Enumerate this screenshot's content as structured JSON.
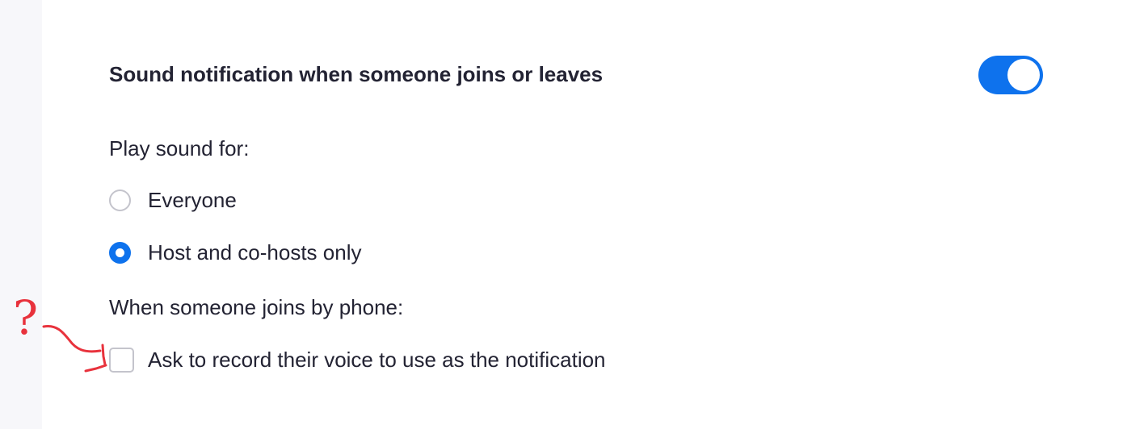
{
  "setting": {
    "title": "Sound notification when someone joins or leaves",
    "enabled": true,
    "accent_color": "#0e72ed"
  },
  "play_sound": {
    "label": "Play sound for:",
    "options": [
      {
        "label": "Everyone",
        "selected": false
      },
      {
        "label": "Host and co-hosts only",
        "selected": true
      }
    ]
  },
  "phone_join": {
    "label": "When someone joins by phone:",
    "record_option": {
      "label": "Ask to record their voice to use as the notification",
      "checked": false
    }
  },
  "annotation": {
    "glyph": "?",
    "color": "#e8323c"
  }
}
